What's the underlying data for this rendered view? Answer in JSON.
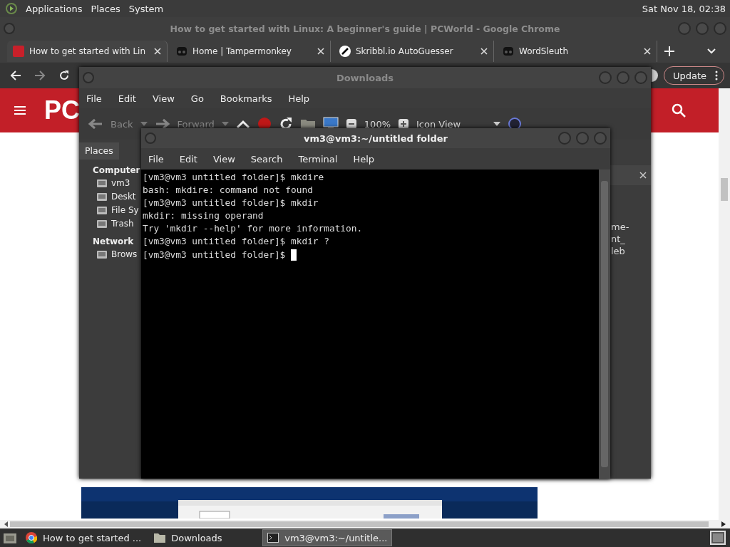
{
  "top_panel": {
    "menus": [
      "Applications",
      "Places",
      "System"
    ],
    "clock": "Sat Nov 18, 02:38"
  },
  "browser": {
    "title": "How to get started with Linux: A beginner's guide | PCWorld - Google Chrome",
    "tabs": [
      {
        "title": "How to get started with Lin",
        "selected": true
      },
      {
        "title": "Home | Tampermonkey",
        "selected": false
      },
      {
        "title": "Skribbl.io AutoGuesser",
        "selected": false
      },
      {
        "title": "WordSleuth",
        "selected": false
      }
    ],
    "update_button": "Update",
    "site_logo": "PC"
  },
  "file_manager": {
    "title": "Downloads",
    "menus": [
      "File",
      "Edit",
      "View",
      "Go",
      "Bookmarks",
      "Help"
    ],
    "toolbar": {
      "back": "Back",
      "forward": "Forward",
      "zoom": "100%",
      "view_mode": "Icon View"
    },
    "sidebar": {
      "header": "Places",
      "sections": [
        {
          "title": "Computer",
          "items": [
            "vm3",
            "Deskt",
            "File Sy",
            "Trash"
          ]
        },
        {
          "title": "Network",
          "items": [
            "Brows"
          ]
        }
      ]
    },
    "file_label_lines": [
      "me-",
      "nt_",
      "leb"
    ]
  },
  "terminal": {
    "title": "vm3@vm3:~/untitled folder",
    "menus": [
      "File",
      "Edit",
      "View",
      "Search",
      "Terminal",
      "Help"
    ],
    "lines": [
      "[vm3@vm3 untitled folder]$ mkdire",
      "bash: mkdire: command not found",
      "[vm3@vm3 untitled folder]$ mkdir",
      "mkdir: missing operand",
      "Try 'mkdir --help' for more information.",
      "[vm3@vm3 untitled folder]$ mkdir ?",
      "[vm3@vm3 untitled folder]$ "
    ]
  },
  "taskbar": {
    "items": [
      {
        "title": "How to get started ...",
        "selected": false
      },
      {
        "title": "Downloads",
        "selected": false
      },
      {
        "title": "vm3@vm3:~/untitle...",
        "selected": true
      }
    ]
  }
}
